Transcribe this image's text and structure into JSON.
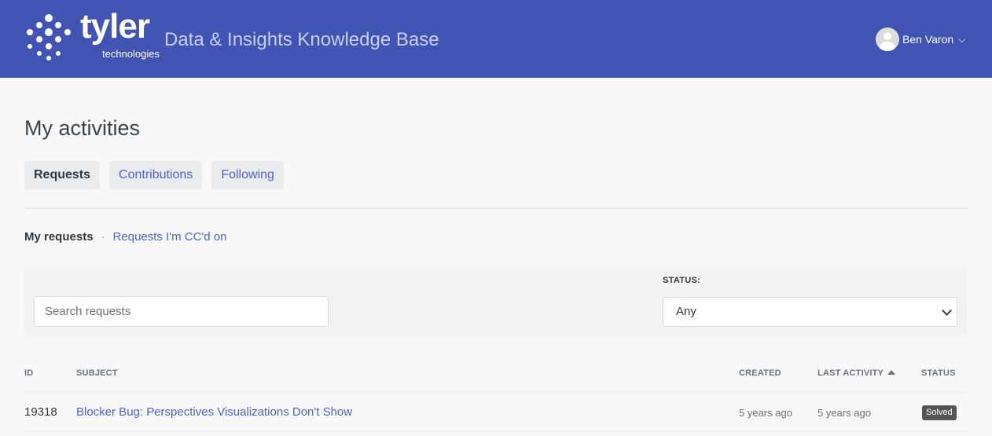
{
  "header": {
    "logo_word": "tyler",
    "logo_sub": "technologies",
    "site_title": "Data & Insights Knowledge Base",
    "user_name": "Ben Varon",
    "brand_color": "#4154b3"
  },
  "page": {
    "title": "My activities"
  },
  "tabs": [
    {
      "label": "Requests",
      "active": true
    },
    {
      "label": "Contributions",
      "active": false
    },
    {
      "label": "Following",
      "active": false
    }
  ],
  "subnav": {
    "current": "My requests",
    "separator": "·",
    "link": "Requests I'm CC'd on"
  },
  "filters": {
    "search_placeholder": "Search requests",
    "status_label": "STATUS:",
    "status_value": "Any"
  },
  "table": {
    "columns": {
      "id": "ID",
      "subject": "SUBJECT",
      "created": "CREATED",
      "last_activity": "LAST ACTIVITY",
      "status": "STATUS"
    },
    "rows": [
      {
        "id": "19318",
        "subject": "Blocker Bug: Perspectives Visualizations Don't Show",
        "created": "5 years ago",
        "last_activity": "5 years ago",
        "status": "Solved"
      }
    ]
  }
}
